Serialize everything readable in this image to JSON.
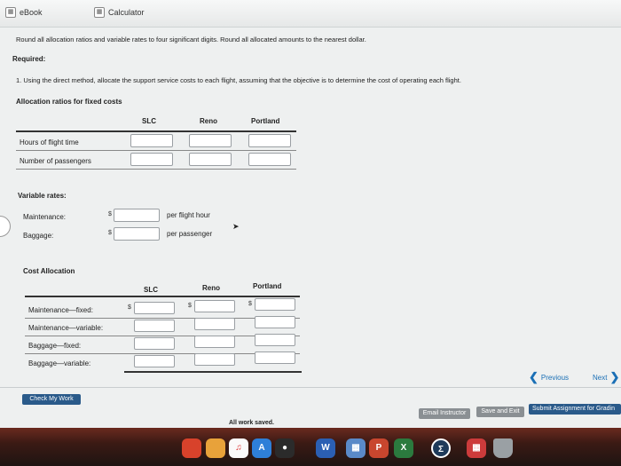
{
  "toolbar": {
    "ebook": "eBook",
    "calculator": "Calculator"
  },
  "instructions": "Round all allocation ratios and variable rates to four significant digits. Round all allocated amounts to the nearest dollar.",
  "required_label": "Required:",
  "question": "1. Using the direct method, allocate the support service costs to each flight, assuming that the objective is to determine the cost of operating each flight.",
  "allocation": {
    "title": "Allocation ratios for fixed costs",
    "columns": [
      "SLC",
      "Reno",
      "Portland"
    ],
    "rows": [
      "Hours of flight time",
      "Number of passengers"
    ]
  },
  "variable": {
    "title": "Variable rates:",
    "rows": [
      {
        "label": "Maintenance:",
        "currency": "$",
        "unit": "per flight hour"
      },
      {
        "label": "Baggage:",
        "currency": "$",
        "unit": "per passenger"
      }
    ]
  },
  "cost": {
    "title": "Cost Allocation",
    "columns": [
      "SLC",
      "Reno",
      "Portland"
    ],
    "currency": "$",
    "rows": [
      "Maintenance—fixed:",
      "Maintenance—variable:",
      "Baggage—fixed:",
      "Baggage—variable:"
    ]
  },
  "nav": {
    "previous": "Previous",
    "next": "Next"
  },
  "buttons": {
    "check": "Check My Work",
    "email": "Email Instructor",
    "save": "Save and Exit",
    "submit": "Submit Assignment for Gradin"
  },
  "status": "All work saved.",
  "dock": {
    "word": "W",
    "powerpoint": "P",
    "excel": "X",
    "sigma": "Σ"
  },
  "colors": {
    "blue": "#1a6fb5",
    "green": "#4d9a3c",
    "button_dark": "#2a5a8a",
    "button_gray": "#8a8f93"
  }
}
